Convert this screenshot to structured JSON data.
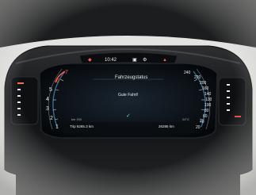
{
  "cluster": {
    "topbar": {
      "time": "10:42"
    },
    "screen": {
      "title": "Fahrzeugstatus",
      "message": "Gute Fahrt!",
      "check_symbol": "✓"
    },
    "rpm_scale": [
      "7",
      "6",
      "5",
      "4",
      "3",
      "2",
      "1"
    ],
    "speed_scale": [
      "240",
      "220",
      "200",
      "160",
      "140",
      "120",
      "100",
      "80",
      "60",
      "40",
      "20"
    ],
    "footer": {
      "range_label": "km 200",
      "trip": "Trip 6265.3 km",
      "odometer": "26285 km",
      "outside_temp": "24°C"
    },
    "colors": {
      "accent_red": "#ff5a45",
      "screen_bg": "#0b0f14",
      "bezel": "#121314"
    },
    "icons": [
      "engine-icon",
      "car-icon",
      "gear-icon",
      "warning-icon",
      "check-icon"
    ]
  }
}
